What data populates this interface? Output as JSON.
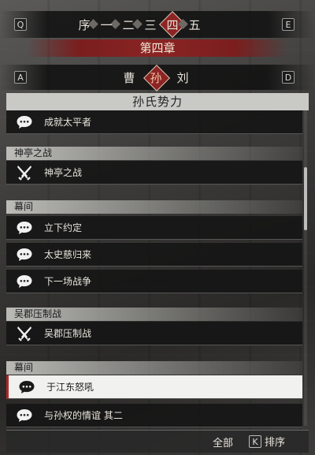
{
  "keys": {
    "prev_chapter": "Q",
    "next_chapter": "E",
    "prev_faction": "A",
    "next_faction": "D",
    "sort": "K"
  },
  "chapter_tabs": [
    "序",
    "一",
    "二",
    "三",
    "四",
    "五"
  ],
  "active_chapter_index": 4,
  "chapter_title": "第四章",
  "faction_tabs": [
    "曹",
    "孙",
    "刘"
  ],
  "active_faction_index": 1,
  "panel_title": "孙氏势力",
  "sections": [
    {
      "header": "",
      "entries": [
        {
          "label": "成就太平者",
          "icon": "speech-bubble-icon"
        }
      ]
    },
    {
      "header": "神亭之战",
      "entries": [
        {
          "label": "神亭之战",
          "icon": "crossed-swords-icon"
        }
      ]
    },
    {
      "header": "幕间",
      "entries": [
        {
          "label": "立下约定",
          "icon": "speech-bubble-icon"
        },
        {
          "label": "太史慈归来",
          "icon": "speech-bubble-icon"
        },
        {
          "label": "下一场战争",
          "icon": "speech-bubble-icon"
        }
      ]
    },
    {
      "header": "吴郡压制战",
      "entries": [
        {
          "label": "吴郡压制战",
          "icon": "crossed-swords-icon"
        }
      ]
    },
    {
      "header": "幕间",
      "entries": [
        {
          "label": "于江东怒吼",
          "icon": "speech-bubble-icon",
          "selected": true
        },
        {
          "label": "与孙权的情谊 其二",
          "icon": "speech-bubble-icon"
        }
      ]
    }
  ],
  "bottom": {
    "all_label": "全部",
    "sort_label": "排序"
  },
  "colors": {
    "accent_red": "#8c2424",
    "selected_bg": "#f1f1ef",
    "entry_bg": "#161616"
  }
}
